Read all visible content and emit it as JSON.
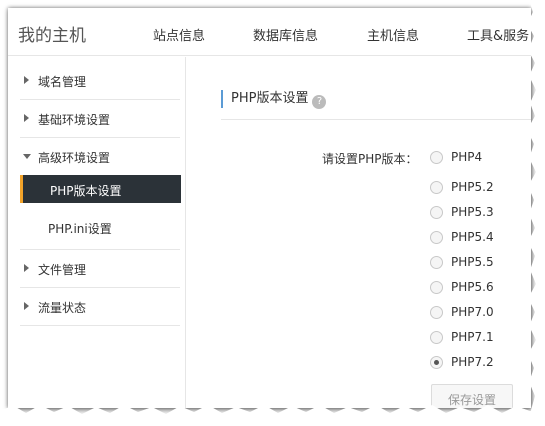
{
  "header": {
    "brand": "我的主机",
    "nav": [
      "站点信息",
      "数据库信息",
      "主机信息",
      "工具&服务"
    ]
  },
  "sidebar": {
    "items": [
      {
        "label": "域名管理",
        "expanded": false
      },
      {
        "label": "基础环境设置",
        "expanded": false
      },
      {
        "label": "高级环境设置",
        "expanded": true
      },
      {
        "label": "文件管理",
        "expanded": false
      },
      {
        "label": "流量状态",
        "expanded": false
      }
    ],
    "subitems": [
      {
        "label": "PHP版本设置",
        "active": true
      },
      {
        "label": "PHP.ini设置",
        "active": false
      }
    ]
  },
  "main": {
    "title": "PHP版本设置",
    "help_icon": "question-circle-icon",
    "field_label": "请设置PHP版本：",
    "options": [
      "PHP4",
      "PHP5.2",
      "PHP5.3",
      "PHP5.4",
      "PHP5.5",
      "PHP5.6",
      "PHP7.0",
      "PHP7.1",
      "PHP7.2"
    ],
    "selected": "PHP7.2",
    "save_label": "保存设置"
  },
  "colors": {
    "active_bg": "#2b3238",
    "active_accent": "#f2a32a",
    "title_accent": "#5b9bd5"
  }
}
